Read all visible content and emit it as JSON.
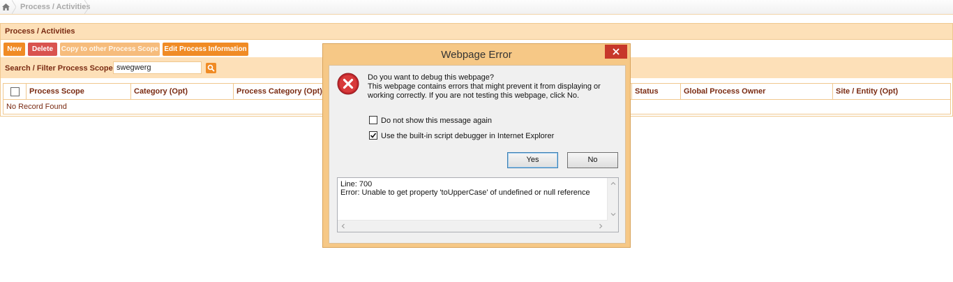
{
  "breadcrumb": {
    "path": "Process / Activities",
    "home_icon": "home-icon"
  },
  "panel": {
    "title": "Process / Activities",
    "toolbar": {
      "new_label": "New",
      "delete_label": "Delete",
      "copy_label": "Copy to other Process Scope",
      "edit_label": "Edit Process Information"
    },
    "filter": {
      "label": "Search / Filter Process Scope",
      "value": "swegwerg",
      "search_icon": "search-icon"
    },
    "grid": {
      "columns": [
        "Process Scope",
        "Category (Opt)",
        "Process Category (Opt)",
        "Status",
        "Global Process Owner",
        "Site / Entity (Opt)"
      ],
      "empty_text": "No Record Found"
    }
  },
  "dialog": {
    "title": "Webpage Error",
    "message_heading": "Do you want to debug this webpage?",
    "message_body": "This webpage contains errors that might prevent it from displaying or working correctly. If you are not testing this webpage, click No.",
    "checkbox_dont_show": {
      "label": "Do not show this message again",
      "checked": false
    },
    "checkbox_use_debugger": {
      "label": "Use the built-in script debugger in Internet Explorer",
      "checked": true
    },
    "yes_label": "Yes",
    "no_label": "No",
    "error_line": "Line: 700",
    "error_text": "Error: Unable to get property 'toUpperCase' of undefined or null reference"
  },
  "colors": {
    "accent_orange": "#f08b25",
    "delete_red": "#d9534f",
    "panel_header": "#fde0b8",
    "label_brown": "#7a2b12",
    "close_red": "#c7382a"
  }
}
